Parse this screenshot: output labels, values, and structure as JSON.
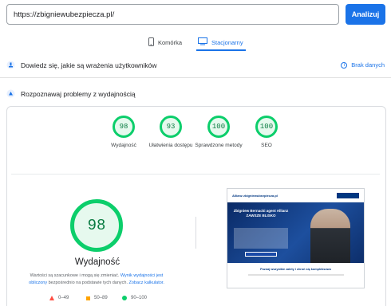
{
  "search": {
    "url_value": "https://zbigniewubezpiecza.pl/",
    "analyze_label": "Analizuj"
  },
  "device_tabs": [
    {
      "label": "Komórka",
      "icon": "phone-icon",
      "active": false
    },
    {
      "label": "Stacjonarny",
      "icon": "desktop-icon",
      "active": true
    }
  ],
  "sections": {
    "field_data": {
      "label": "Dowiedz się, jakie są wrażenia użytkowników",
      "no_data_label": "Brak danych"
    },
    "lab_data": {
      "label": "Rozpoznawaj problemy z wydajnością"
    }
  },
  "scores": [
    {
      "label": "Wydajność",
      "value": "98"
    },
    {
      "label": "Ułatwienia dostępu",
      "value": "93"
    },
    {
      "label": "Sprawdzone metody",
      "value": "100"
    },
    {
      "label": "SEO",
      "value": "100"
    }
  ],
  "performance": {
    "score": "98",
    "title": "Wydajność",
    "note_text": "Wartości są szacunkowe i mogą się zmieniać.",
    "note_link": "Wynik wydajności jest obliczony",
    "note_text_2": "bezpośrednio na podstawie tych danych.",
    "calculator_link": "Zobacz kalkulator."
  },
  "legend": [
    {
      "range": "0–49",
      "color": "#ff4e42"
    },
    {
      "range": "50–89",
      "color": "#ffa400"
    },
    {
      "range": "90–100",
      "color": "#0cce6b"
    }
  ],
  "thumbnail": {
    "logo_text": "Allianz zbigniewubezpiecza.pl",
    "headline": "Zbigniew Bernacki agent Allianz ZAWSZE BLISKO",
    "bottom_text": "Poznaj wszystkie zalety i chroń się kompleksowo"
  },
  "colors": {
    "accent": "#1a73e8",
    "pass": "#0cce6b",
    "average": "#ffa400",
    "fail": "#ff4e42"
  }
}
